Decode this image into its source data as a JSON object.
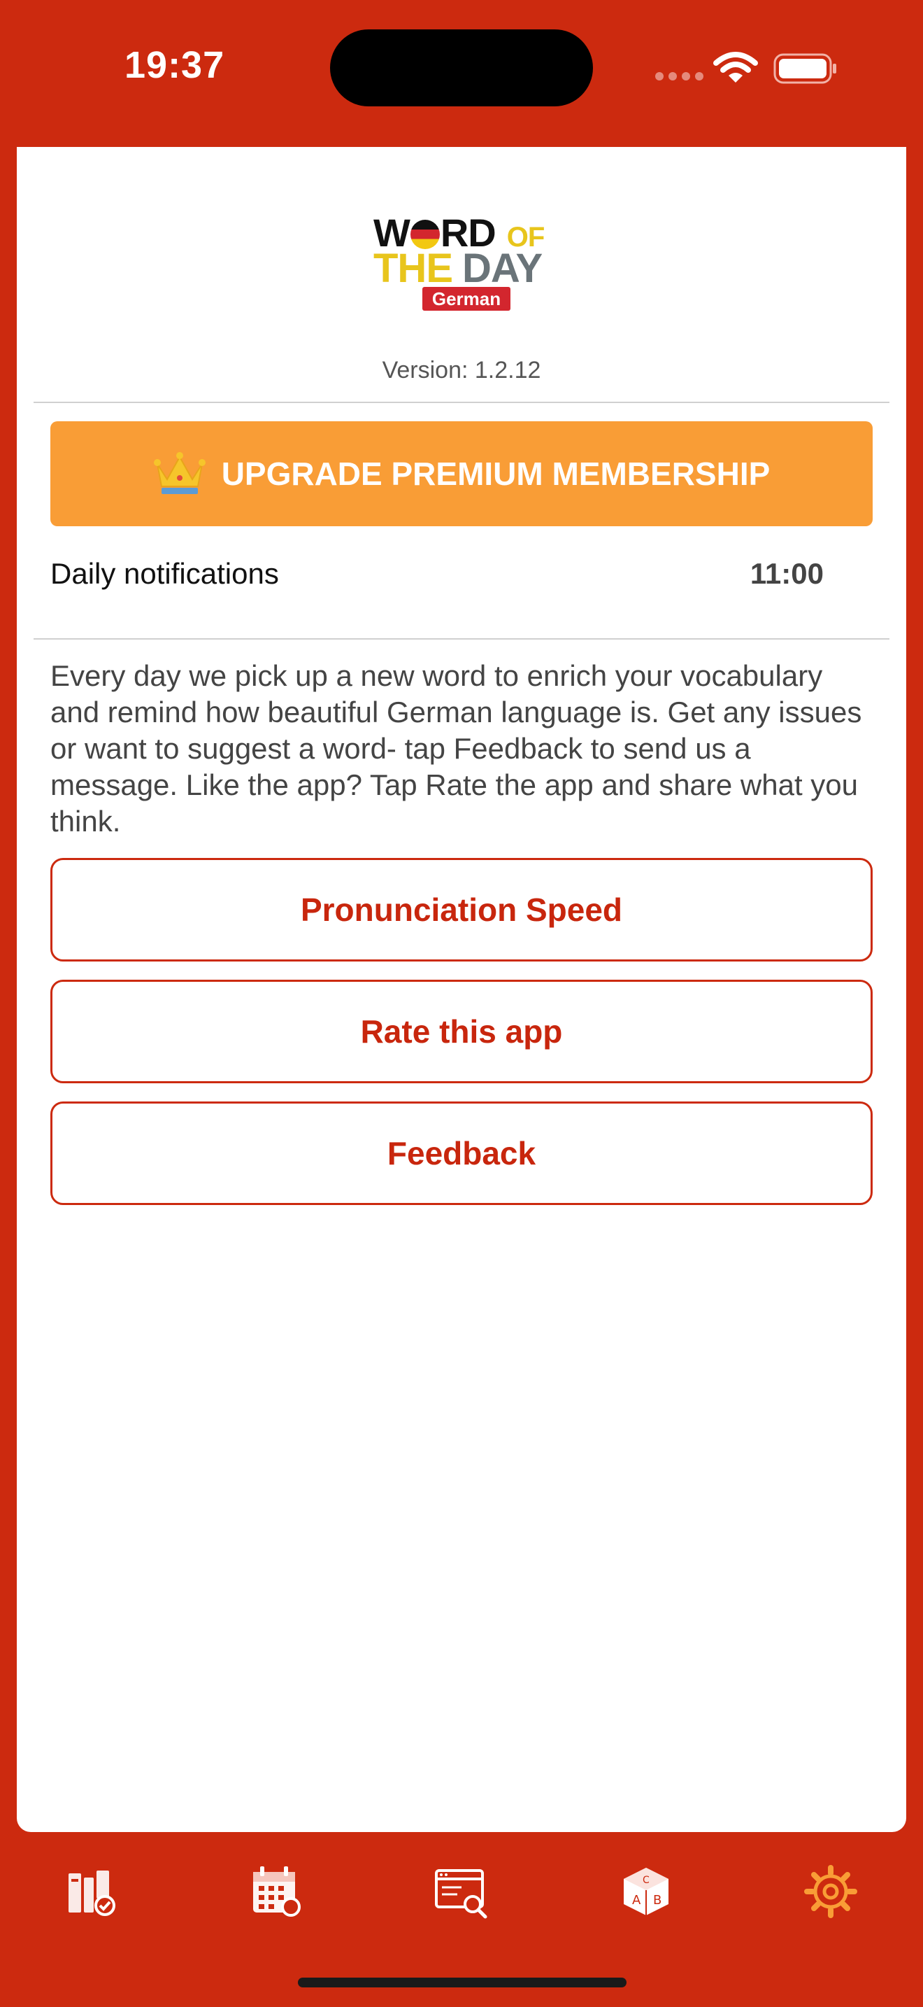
{
  "status_bar": {
    "time": "19:37"
  },
  "header": {
    "logo": {
      "line1_w": "W",
      "line1_rd": "RD",
      "line1_of": "OF",
      "line2_the": "THE",
      "line2_day": "DAY",
      "badge": "German"
    },
    "version": "Version: 1.2.12"
  },
  "premium": {
    "label": "UPGRADE PREMIUM MEMBERSHIP",
    "icon": "crown-icon"
  },
  "notifications": {
    "label": "Daily notifications",
    "time": "11:00"
  },
  "description": "Every day we pick up a new word to enrich your vocabulary and remind how  beautiful German language is. Get any issues or want to suggest a word- tap Feedback to send us a message. Like the app? Tap Rate the app and share what you think.",
  "buttons": {
    "pronunciation": "Pronunciation Speed",
    "rate": "Rate this app",
    "feedback": "Feedback"
  },
  "tab_bar": {
    "tabs": [
      {
        "icon": "library-check-icon",
        "active": false
      },
      {
        "icon": "calendar-icon",
        "active": false
      },
      {
        "icon": "browser-search-icon",
        "active": false
      },
      {
        "icon": "letter-cube-icon",
        "active": false
      },
      {
        "icon": "settings-gear-icon",
        "active": true
      }
    ]
  },
  "colors": {
    "brand_red": "#CC2A0F",
    "premium_orange": "#F99D36",
    "active_tab": "#F99D36"
  }
}
